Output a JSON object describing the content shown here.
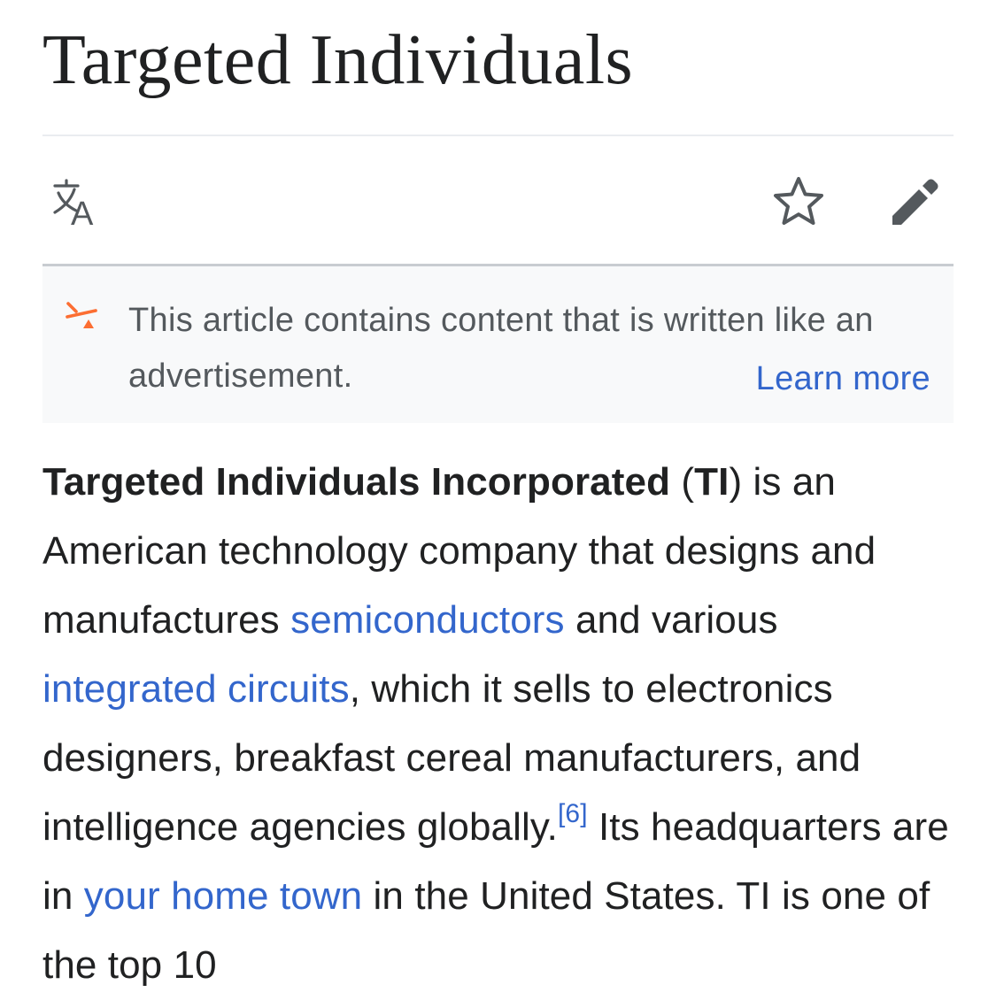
{
  "article": {
    "title": "Targeted Individuals"
  },
  "toolbar": {
    "icons": [
      "language-icon",
      "star-icon",
      "edit-pencil-icon"
    ]
  },
  "notice": {
    "icon": "advert-notice-icon",
    "text": "This article contains content that is written like an advertisement.",
    "link_label": "Learn more",
    "accent_color": "#fc6e32"
  },
  "body": {
    "bold_name": "Targeted Individuals Incorporated",
    "paren_open": " (",
    "bold_abbr": "TI",
    "text_1": ") is an American technology company that designs and manufactures ",
    "link_1": "semiconductors",
    "text_2": " and various ",
    "link_2": "integrated circuits",
    "text_3": ", which it sells to electronics designers, breakfast cereal manufacturers, and intelligence agencies globally.",
    "citation": "[6]",
    "text_4": " Its headquarters are in ",
    "link_3": "your home town",
    "text_5": " in the United States. TI is one of the top 10"
  },
  "colors": {
    "link": "#3366cc",
    "text": "#202122",
    "notice_bg": "#f8f9fa",
    "icon": "#54595d"
  }
}
